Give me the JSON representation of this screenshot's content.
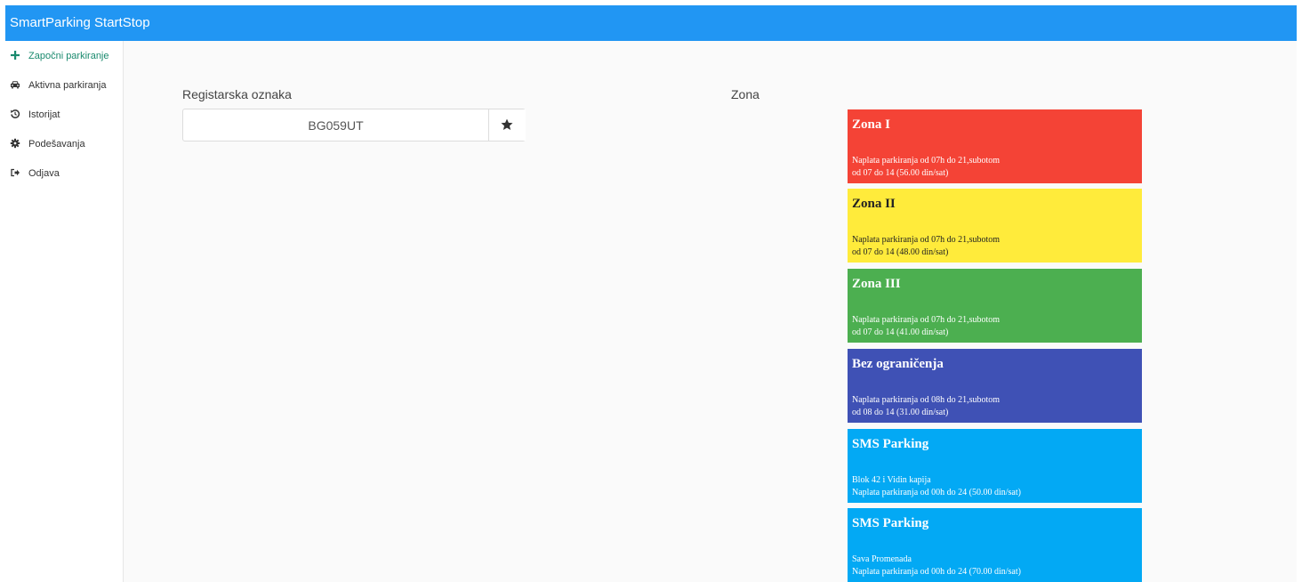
{
  "header": {
    "title": "SmartParking StartStop"
  },
  "sidebar": {
    "items": [
      {
        "label": "Započni parkiranje",
        "icon": "plus-icon",
        "active": true
      },
      {
        "label": "Aktivna parkiranja",
        "icon": "car-icon",
        "active": false
      },
      {
        "label": "Istorijat",
        "icon": "history-icon",
        "active": false
      },
      {
        "label": "Podešavanja",
        "icon": "gear-icon",
        "active": false
      },
      {
        "label": "Odjava",
        "icon": "sign-out-icon",
        "active": false
      }
    ]
  },
  "form": {
    "reg_label": "Registarska oznaka",
    "reg_value": "BG059UT",
    "favorite_icon": "star-icon",
    "zona_label": "Zona"
  },
  "zones": [
    {
      "name": "Zona I",
      "desc": "Naplata parkiranja od 07h do 21,subotom\nod 07 do 14 (56.00 din/sat)",
      "color": "#f44336"
    },
    {
      "name": "Zona II",
      "desc": "Naplata parkiranja od 07h do 21,subotom\nod 07 do 14 (48.00 din/sat)",
      "color": "#ffeb3b"
    },
    {
      "name": "Zona III",
      "desc": "Naplata parkiranja od 07h do 21,subotom\nod 07 do 14 (41.00 din/sat)",
      "color": "#4caf50"
    },
    {
      "name": "Bez ograničenja",
      "desc": "Naplata parkiranja od 08h do 21,subotom\nod 08 do 14 (31.00 din/sat)",
      "color": "#3f51b5"
    },
    {
      "name": "SMS Parking",
      "desc": "Blok 42 i Vidin kapija\nNaplata parkiranja od 00h do 24 (50.00 din/sat)",
      "color": "#03a9f4"
    },
    {
      "name": "SMS Parking",
      "desc": "Sava Promenada\nNaplata parkiranja od 00h do 24 (70.00 din/sat)",
      "color": "#03a9f4"
    }
  ]
}
